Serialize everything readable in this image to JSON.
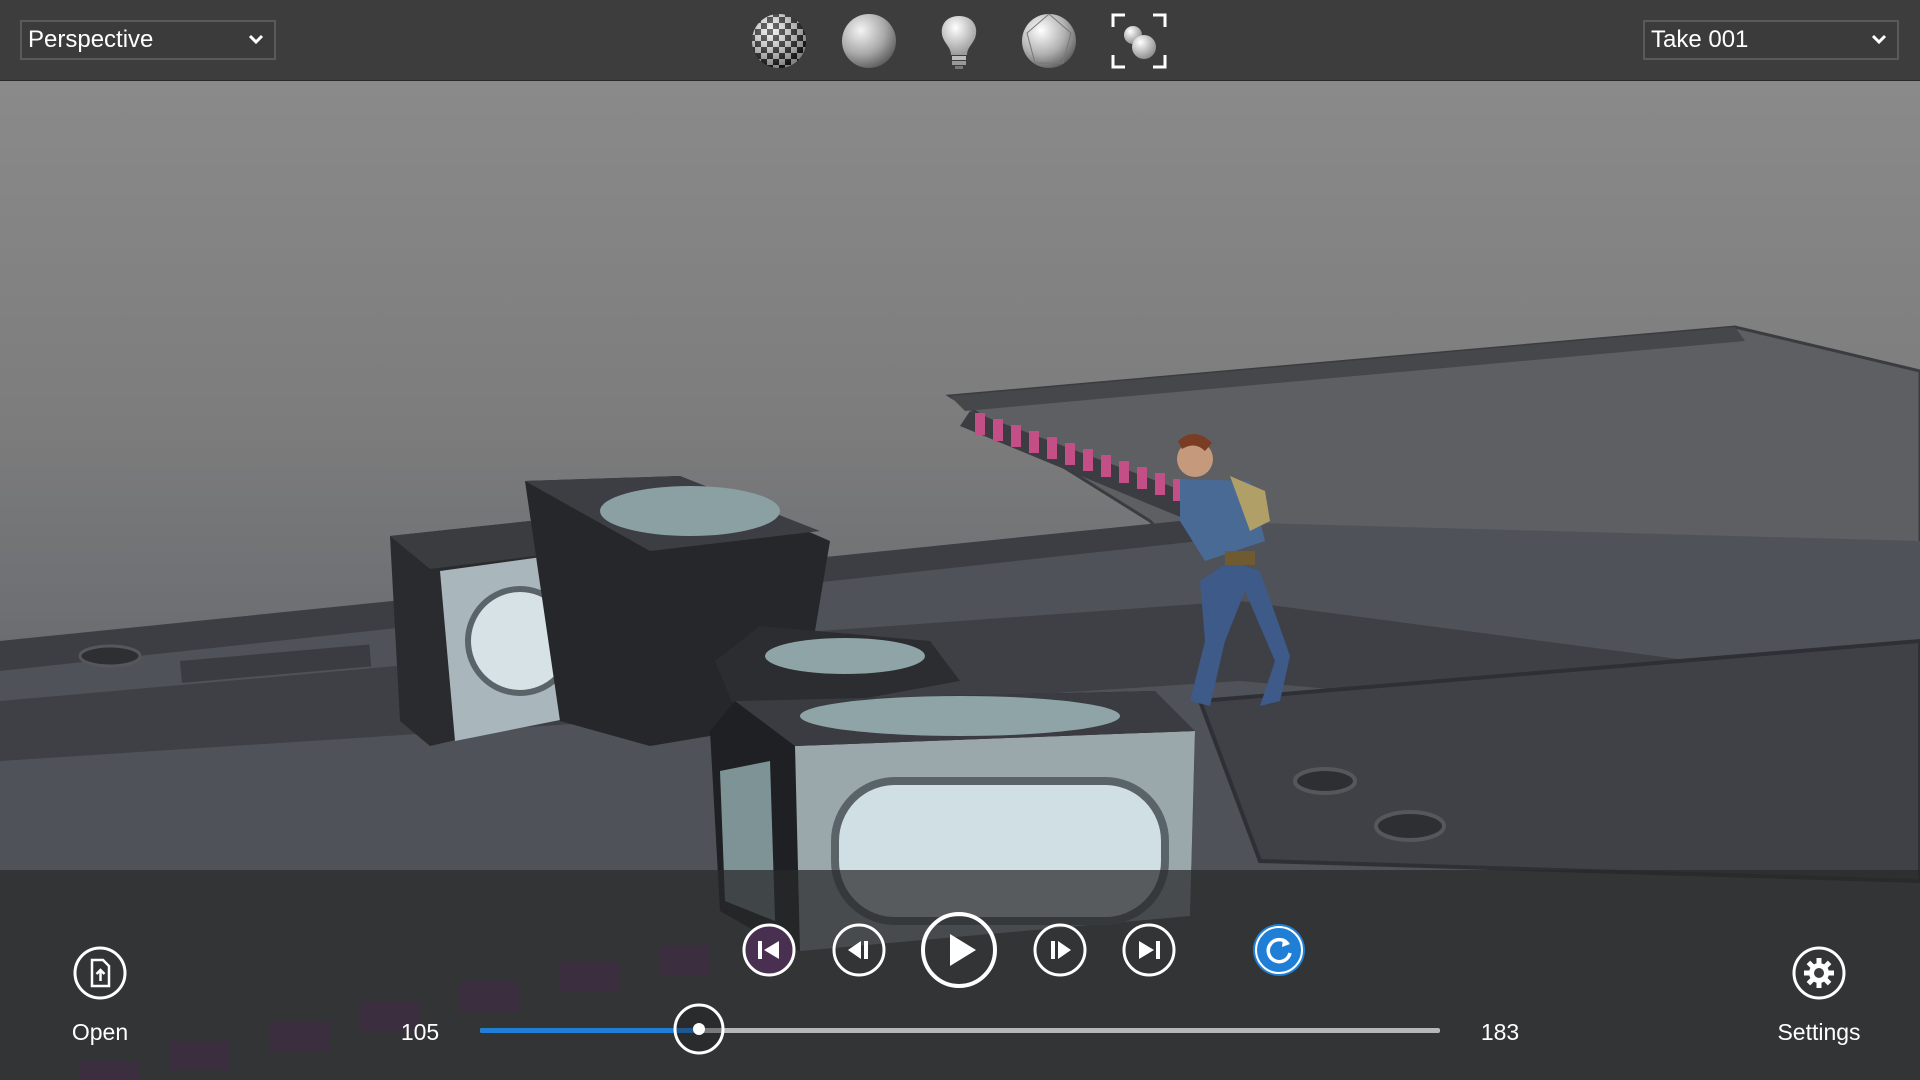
{
  "toolbar": {
    "camera_view": "Perspective",
    "animation_take": "Take 001",
    "icons": [
      "checker-material-icon",
      "flat-sphere-icon",
      "light-bulb-icon",
      "wireframe-sphere-icon",
      "frame-all-icon"
    ]
  },
  "transport": {
    "open_label": "Open",
    "settings_label": "Settings",
    "start_frame": "105",
    "end_frame": "183",
    "progress_fraction": 0.228
  },
  "colors": {
    "accent": "#1f7fd6",
    "toolbar_bg": "#3d3d3d"
  }
}
